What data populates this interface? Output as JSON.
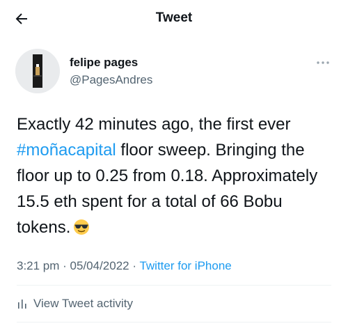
{
  "header": {
    "title": "Tweet",
    "back_icon": "arrow-left-icon"
  },
  "author": {
    "name": "felipe pages",
    "handle": "@PagesAndres",
    "avatar_icon": "profile-avatar"
  },
  "tweet": {
    "text_part1": "Exactly 42 minutes ago, the first ever ",
    "hashtag": "#moñacapital",
    "text_part2": " floor sweep. Bringing the floor up to 0.25 from 0.18. Approximately 15.5 eth spent for a total of 66 Bobu tokens.",
    "emoji_icon": "smiling-face-with-sunglasses"
  },
  "meta": {
    "time": "3:21 pm",
    "separator": " · ",
    "date": "05/04/2022",
    "source": "Twitter for iPhone"
  },
  "activity": {
    "label": "View Tweet activity",
    "icon": "bar-chart-icon"
  },
  "colors": {
    "accent": "#1d9bf0",
    "text": "#0f1419",
    "secondary": "#536471"
  }
}
